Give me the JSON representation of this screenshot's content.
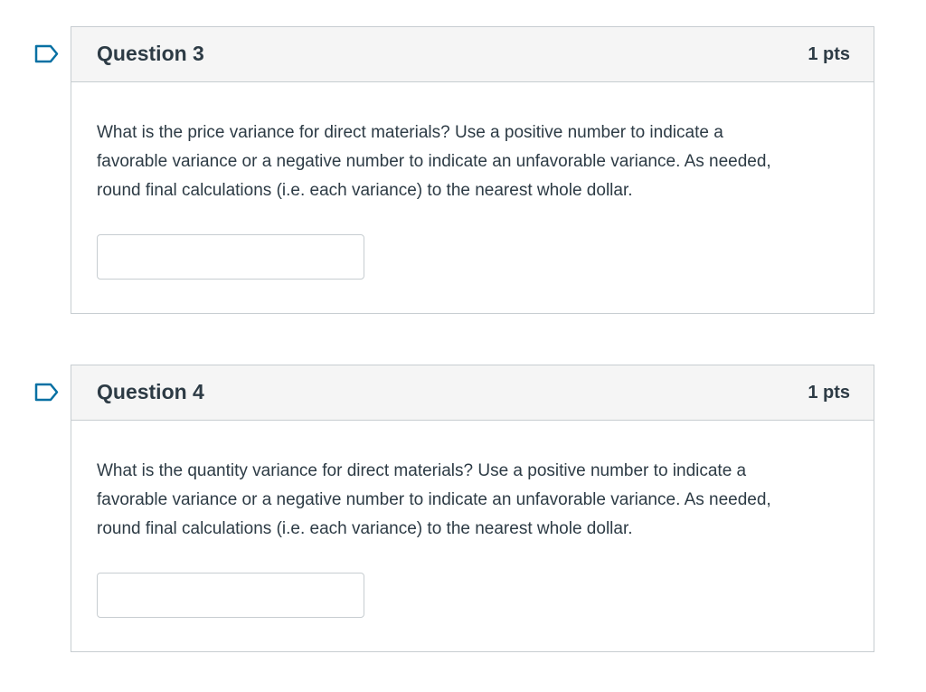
{
  "questions": [
    {
      "flag_icon": "bookmark-flag-icon",
      "title": "Question 3",
      "points": "1 pts",
      "text": "What is the price variance for direct materials? Use a positive number to indicate a\nfavorable variance or a negative number to indicate an unfavorable variance.  As needed,\nround final calculations (i.e. each variance) to the nearest whole dollar.",
      "answer_value": ""
    },
    {
      "flag_icon": "bookmark-flag-icon",
      "title": "Question 4",
      "points": "1 pts",
      "text": "What is the quantity variance for direct materials? Use a positive number to indicate a\nfavorable variance or a negative number to indicate an unfavorable variance.  As needed,\nround final calculations (i.e. each variance) to the nearest whole dollar.",
      "answer_value": ""
    }
  ],
  "colors": {
    "flag_blue": "#0770a3",
    "header_bg": "#f5f5f5",
    "border": "#c7cdd1",
    "text": "#2d3b45"
  }
}
